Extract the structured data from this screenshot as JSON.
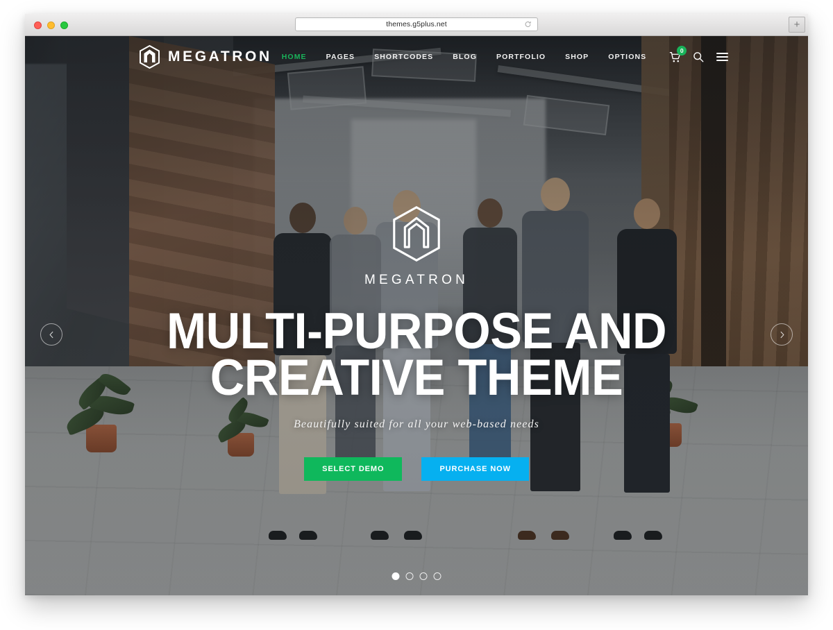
{
  "browser": {
    "url": "themes.g5plus.net",
    "reload_icon": "reload-icon",
    "new_tab_label": "+",
    "traffic_lights": [
      "close",
      "minimize",
      "zoom"
    ]
  },
  "site": {
    "header": {
      "brand": {
        "logo_icon": "megatron-hexagon-logo",
        "name": "MEGATRON"
      },
      "nav_items": [
        {
          "label": "HOME",
          "active": true
        },
        {
          "label": "PAGES",
          "active": false
        },
        {
          "label": "SHORTCODES",
          "active": false
        },
        {
          "label": "BLOG",
          "active": false
        },
        {
          "label": "PORTFOLIO",
          "active": false
        },
        {
          "label": "SHOP",
          "active": false
        },
        {
          "label": "OPTIONS",
          "active": false
        }
      ],
      "icons": {
        "cart": "cart-icon",
        "cart_count": "0",
        "search": "search-icon",
        "menu": "hamburger-menu-icon"
      }
    },
    "hero": {
      "logo_icon": "megatron-hexagon-logo",
      "logo_name": "MEGATRON",
      "title_line_1": "MULTI-PURPOSE AND",
      "title_line_2": "CREATIVE THEME",
      "subtitle": "Beautifully suited for all your web-based needs",
      "primary_button": "SELECT DEMO",
      "secondary_button": "PURCHASE NOW",
      "prev_arrow_icon": "chevron-left-icon",
      "next_arrow_icon": "chevron-right-icon",
      "slides": [
        {
          "index": 1,
          "active": true
        },
        {
          "index": 2,
          "active": false
        },
        {
          "index": 3,
          "active": false
        },
        {
          "index": 4,
          "active": false
        }
      ]
    }
  },
  "colors": {
    "accent_green": "#19b35a",
    "button_green": "#0fb85c",
    "button_blue": "#06b0f0",
    "nav_text": "#f1f1f1",
    "page_background": "#ffffff"
  }
}
